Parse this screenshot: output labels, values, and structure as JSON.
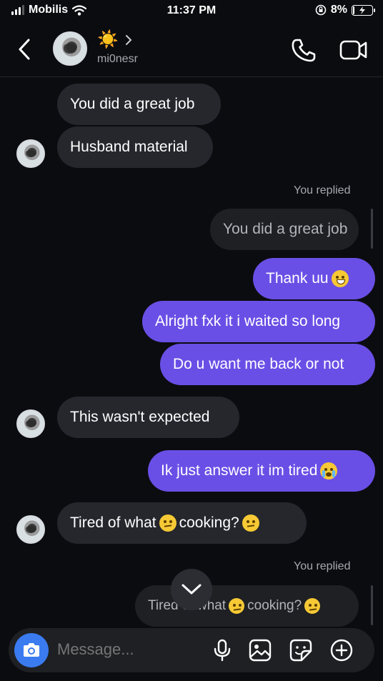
{
  "status_bar": {
    "carrier": "Mobilis",
    "time": "11:37 PM",
    "battery": "8%",
    "battery_level": 0.08
  },
  "header": {
    "display_name_emoji": "☀️",
    "username": "mi0nesr"
  },
  "messages": [
    {
      "side": "in",
      "text": "You did a great job"
    },
    {
      "side": "in",
      "text": "Husband material"
    },
    {
      "side": "meta",
      "text": "You replied"
    },
    {
      "side": "reply",
      "text": "You did a great job"
    },
    {
      "side": "out",
      "text": "Thank uu",
      "emoji": "grin"
    },
    {
      "side": "out",
      "text": "Alright fxk it i waited so long"
    },
    {
      "side": "out",
      "text": "Do u want me back or not"
    },
    {
      "side": "in",
      "text": "This wasn't expected"
    },
    {
      "side": "out",
      "text": "Ik just answer it im tired",
      "emoji": "cry"
    },
    {
      "side": "in",
      "text_a": "Tired of what",
      "text_b": "cooking?",
      "emoji": "raised-eyebrow"
    },
    {
      "side": "meta",
      "text": "You replied"
    },
    {
      "side": "reply",
      "text_a": "Tired of what",
      "text_b": "cooking?",
      "emoji": "raised-eyebrow"
    }
  ],
  "composer": {
    "placeholder": "Message..."
  },
  "icons": [
    "back-icon",
    "chevron-right-icon",
    "phone-icon",
    "video-camera-icon",
    "camera-icon",
    "microphone-icon",
    "gallery-icon",
    "sticker-icon",
    "plus-icon",
    "chevron-down-icon"
  ],
  "colors": {
    "outgoing": "#6a4fe6",
    "incoming": "#25272d",
    "camera": "#3a7bf0"
  }
}
